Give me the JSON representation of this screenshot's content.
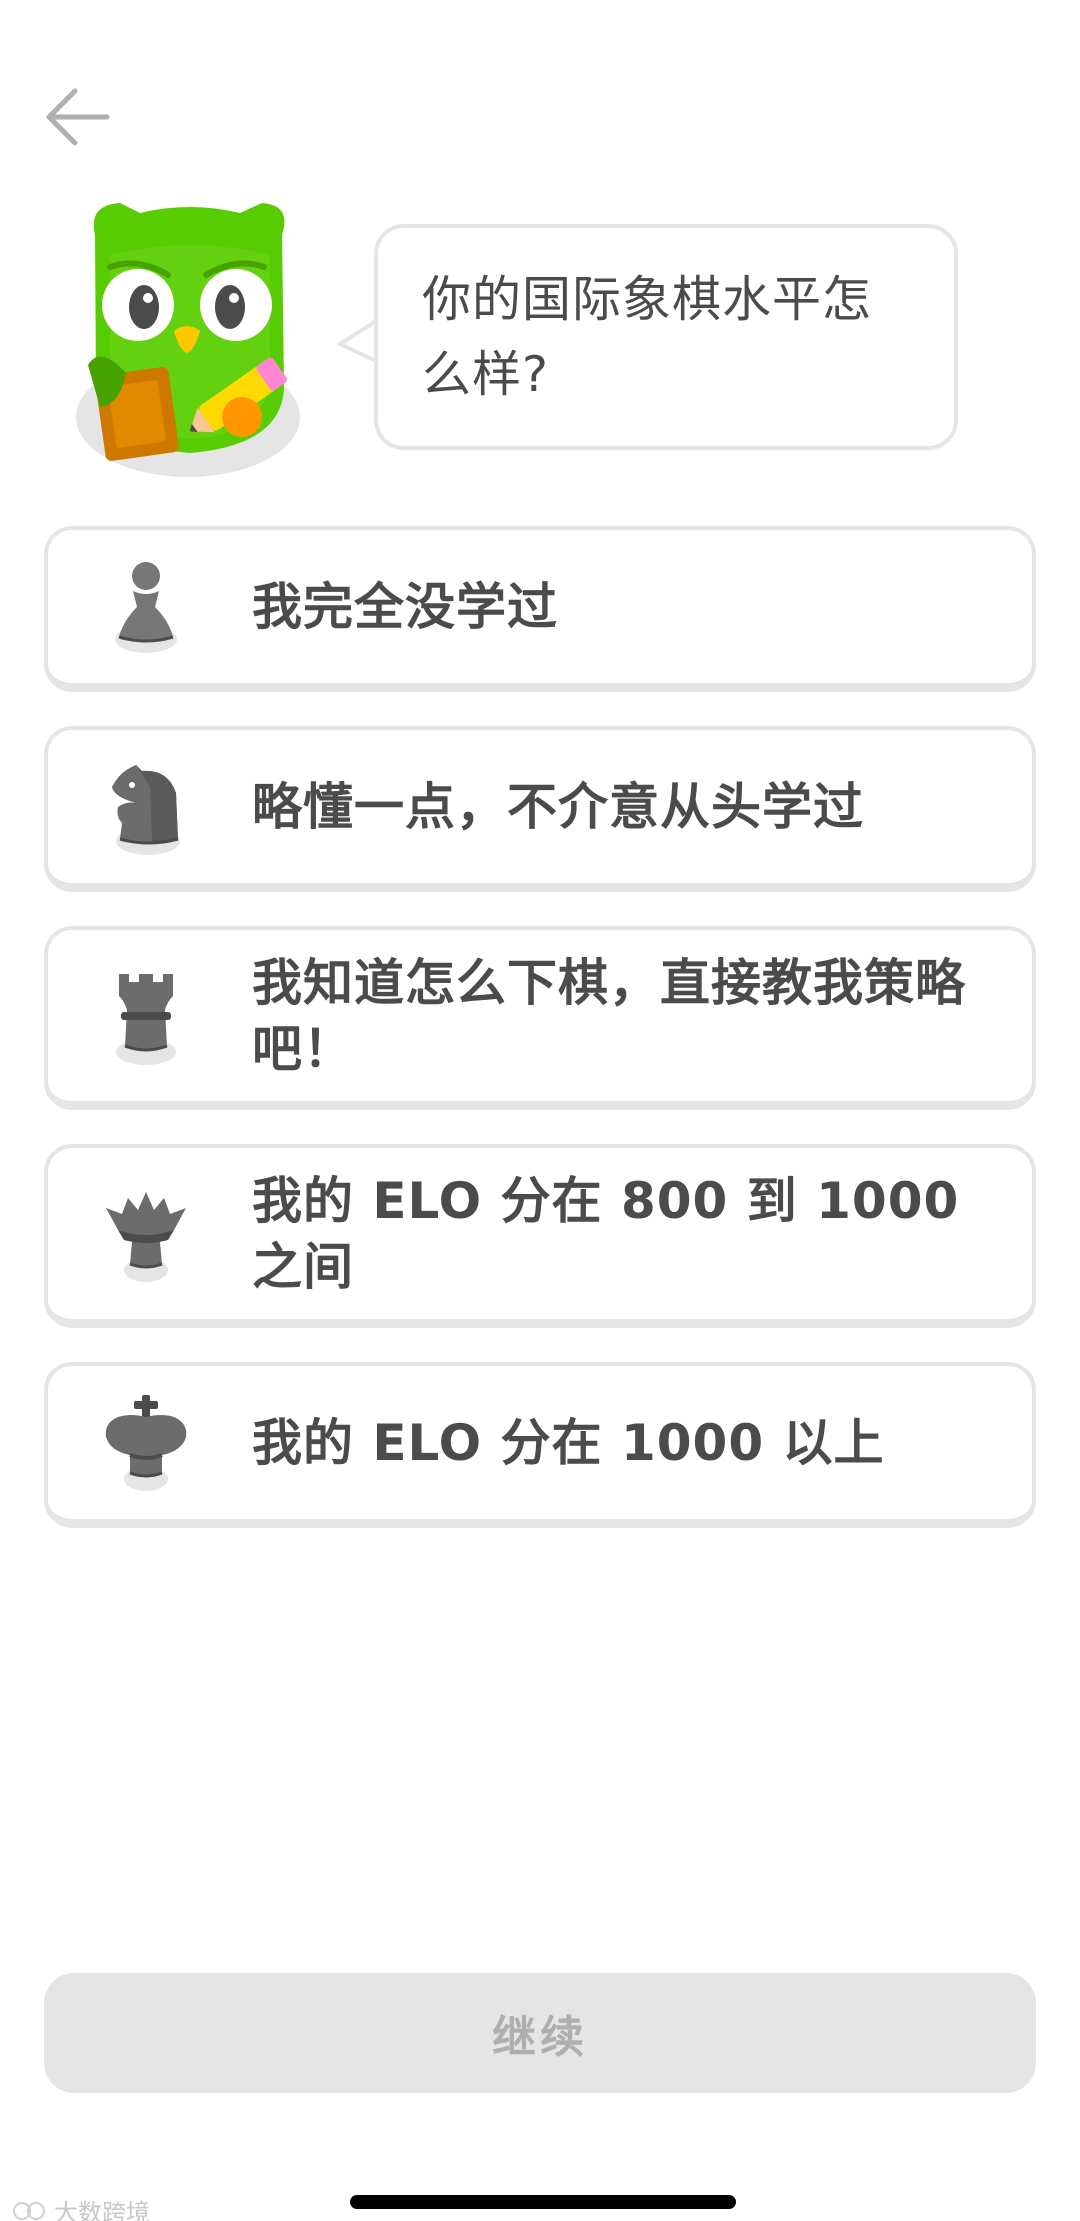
{
  "header": {
    "back_icon": "arrow-left-icon"
  },
  "mascot": {
    "icon": "duo-owl-with-clipboard-and-pencil",
    "speech": "你的国际象棋水平怎么样?"
  },
  "options": [
    {
      "label": "我完全没学过",
      "icon": "chess-pawn-icon"
    },
    {
      "label": "略懂一点，不介意从头学过",
      "icon": "chess-knight-icon"
    },
    {
      "label": "我知道怎么下棋，直接教我策略吧！",
      "icon": "chess-rook-icon"
    },
    {
      "label": "我的 ELO 分在 800 到 1000 之间",
      "icon": "chess-queen-icon"
    },
    {
      "label": "我的 ELO 分在 1000 以上",
      "icon": "chess-king-icon"
    }
  ],
  "footer": {
    "continue_label": "继续",
    "continue_enabled": false
  },
  "watermark": {
    "text": "大数跨境"
  },
  "colors": {
    "text": "#4b4b4b",
    "border": "#e5e5e5",
    "disabled_button": "#e5e5e5",
    "disabled_text": "#afafaf",
    "owl_green": "#58cc02"
  }
}
